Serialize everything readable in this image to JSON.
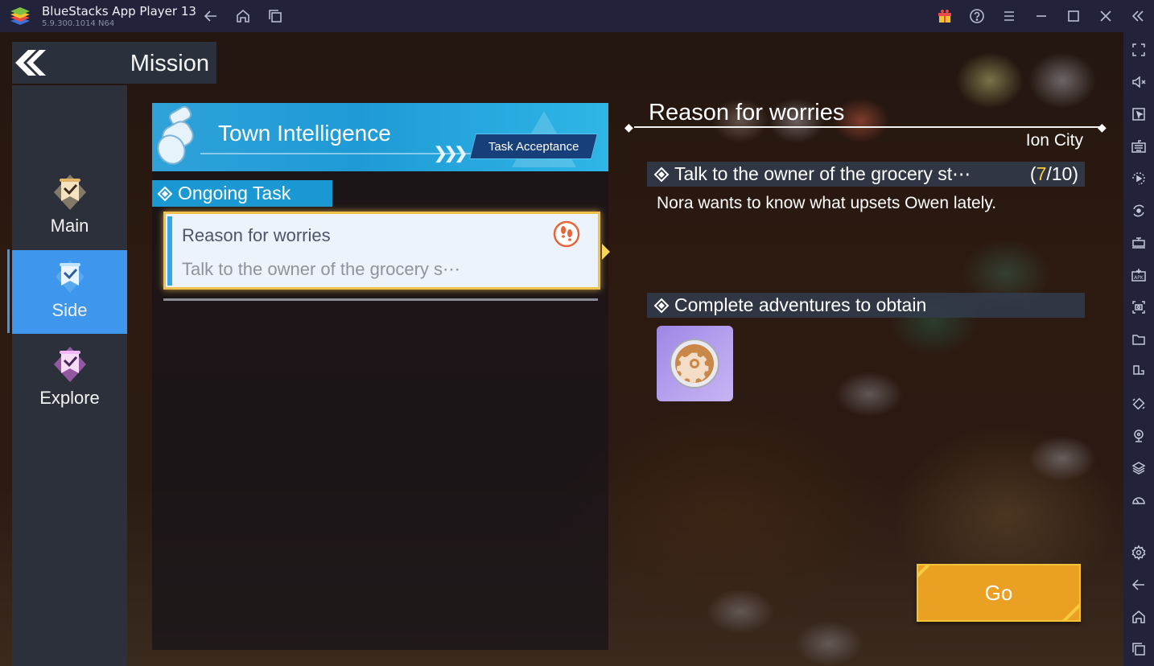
{
  "titlebar": {
    "app_name": "BlueStacks App Player 13",
    "version": "5.9.300.1014  N64",
    "nav_icons": [
      "back-arrow-icon",
      "home-icon",
      "recent-apps-icon"
    ],
    "right_icons": [
      "gift-icon",
      "help-icon",
      "menu-icon",
      "minimize-icon",
      "maximize-icon",
      "close-icon",
      "collapse-sidebar-icon"
    ]
  },
  "game": {
    "header": {
      "title": "Mission"
    },
    "nav": {
      "items": [
        {
          "label": "Main",
          "icon": "main-mission-icon",
          "active": false
        },
        {
          "label": "Side",
          "icon": "side-mission-icon",
          "active": true
        },
        {
          "label": "Explore",
          "icon": "explore-mission-icon",
          "active": false
        }
      ]
    },
    "banner": {
      "title": "Town Intelligence",
      "button": "Task Acceptance"
    },
    "ongoing": {
      "label": "Ongoing Task"
    },
    "task_card": {
      "title": "Reason for worries",
      "subtitle": "Talk to the owner of the grocery s⋯",
      "icon": "footprints-icon"
    },
    "detail": {
      "title": "Reason for worries",
      "location": "Ion City",
      "objective": "Talk to the owner of the grocery st⋯",
      "progress_open": "(",
      "progress_current": "7",
      "progress_total": "/10)",
      "description": "Nora wants to know what upsets Owen lately.",
      "rewards_header": "Complete adventures to obtain",
      "reward_icon": "gear-coin-icon"
    },
    "go_button": "Go",
    "colors": {
      "accent_blue": "#3e97ec",
      "banner_blue": "#1f9ad6",
      "go_orange": "#eaa123",
      "progress_yellow": "#f4cc3a",
      "reward_purple": "#b9a4ef"
    }
  },
  "rightbar": {
    "icons": [
      "fullscreen-icon",
      "mute-icon",
      "cursor-icon",
      "keyboard-icon",
      "macro-record-icon",
      "rotate-sync-icon",
      "atm-icon",
      "apk-install-icon",
      "screenshot-icon",
      "folder-icon",
      "multi-instance-icon",
      "rotate-screen-icon",
      "location-icon",
      "layers-icon",
      "performance-icon",
      "settings-icon",
      "back-icon",
      "home-icon",
      "recents-icon"
    ]
  }
}
